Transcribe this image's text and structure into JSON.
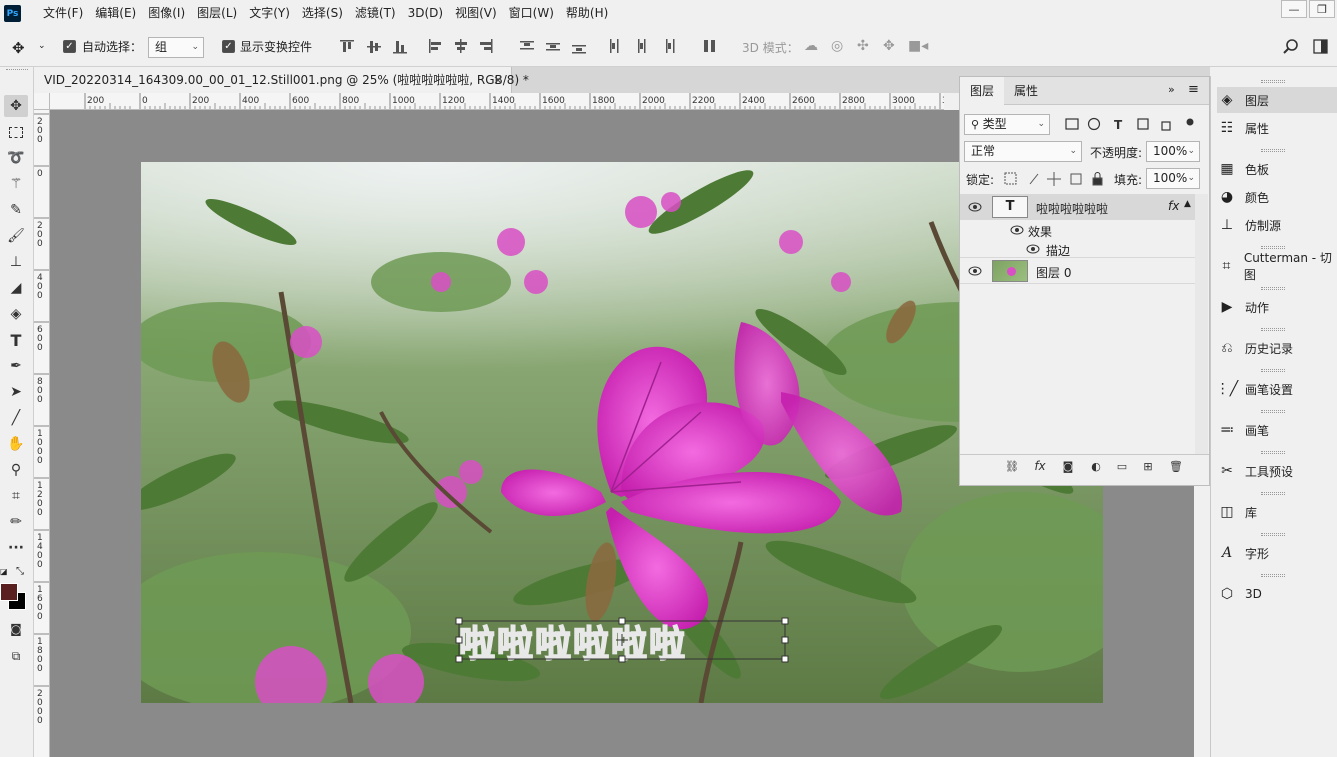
{
  "app": {
    "logo": "Ps"
  },
  "menu": [
    "文件(F)",
    "编辑(E)",
    "图像(I)",
    "图层(L)",
    "文字(Y)",
    "选择(S)",
    "滤镜(T)",
    "3D(D)",
    "视图(V)",
    "窗口(W)",
    "帮助(H)"
  ],
  "window_controls": {
    "minimize": "—",
    "restore": "❐"
  },
  "options": {
    "auto_select_label": "自动选择：",
    "auto_select_checked": true,
    "auto_select_target": "组",
    "show_transform_label": "显示变换控件",
    "show_transform_checked": true,
    "mode_3d_label": "3D 模式："
  },
  "document": {
    "tab_title": "VID_20220314_164309.00_00_01_12.Still001.png @ 25% (啦啦啦啦啦啦, RGB/8) *",
    "close": "×"
  },
  "ruler": {
    "h_ticks": [
      "200",
      "0",
      "200",
      "400",
      "600",
      "800",
      "1000",
      "1200",
      "1400",
      "1600",
      "1800",
      "2000",
      "2200",
      "2400",
      "2600",
      "2800",
      "3000",
      "32"
    ],
    "v_ticks": [
      "2\n0\n0",
      "0",
      "2\n0\n0",
      "4\n0\n0",
      "6\n0\n0",
      "8\n0\n0",
      "1\n0\n0\n0",
      "1\n2\n0\n0",
      "1\n4\n0\n0",
      "1\n6\n0\n0",
      "1\n8\n0\n0",
      "2\n0\n0\n0"
    ]
  },
  "canvas": {
    "text_layer_content": "啦啦啦啦啦啦",
    "colors": {
      "bg": "#8a8a8a",
      "foreground": "#5a2020",
      "background": "#000000"
    }
  },
  "layers_panel": {
    "tabs": [
      "图层",
      "属性"
    ],
    "active_tab": "图层",
    "filter_kind": "类型",
    "blend_mode": "正常",
    "opacity_label": "不透明度:",
    "opacity_value": "100%",
    "lock_label": "锁定:",
    "fill_label": "填充:",
    "fill_value": "100%",
    "layers": [
      {
        "name": "啦啦啦啦啦啦",
        "kind": "text",
        "fx": "fx",
        "selected": true,
        "effects_label": "效果",
        "effects": [
          "描边"
        ]
      },
      {
        "name": "图层 0",
        "kind": "image",
        "selected": false
      }
    ]
  },
  "dock": [
    {
      "label": "图层",
      "icon": "layers-icon",
      "active": true
    },
    {
      "label": "属性",
      "icon": "properties-icon",
      "active": false
    },
    {
      "label": "色板",
      "icon": "swatches-icon",
      "active": false
    },
    {
      "label": "颜色",
      "icon": "color-palette-icon",
      "active": false
    },
    {
      "label": "仿制源",
      "icon": "clone-source-icon",
      "active": false
    },
    {
      "label": "Cutterman - 切图",
      "icon": "cutterman-icon",
      "active": false
    },
    {
      "label": "动作",
      "icon": "actions-play-icon",
      "active": false
    },
    {
      "label": "历史记录",
      "icon": "history-icon",
      "active": false
    },
    {
      "label": "画笔设置",
      "icon": "brush-settings-icon",
      "active": false
    },
    {
      "label": "画笔",
      "icon": "brushes-icon",
      "active": false
    },
    {
      "label": "工具预设",
      "icon": "tool-presets-icon",
      "active": false
    },
    {
      "label": "库",
      "icon": "libraries-icon",
      "active": false
    },
    {
      "label": "字形",
      "icon": "glyphs-icon",
      "active": false
    },
    {
      "label": "3D",
      "icon": "3d-cube-icon",
      "active": false
    }
  ]
}
